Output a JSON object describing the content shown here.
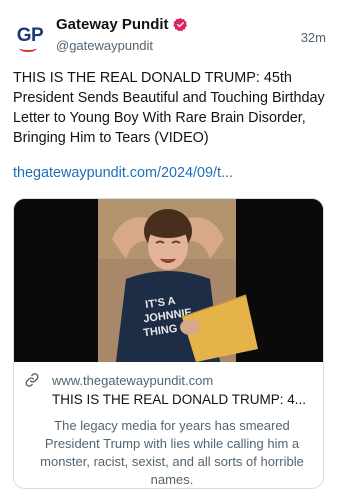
{
  "author": {
    "avatar_text": "GP",
    "display_name": "Gateway Pundit",
    "handle": "@gatewaypundit",
    "verified": true
  },
  "timestamp": "32m",
  "post": {
    "text": "THIS IS THE REAL DONALD TRUMP: 45th President Sends Beautiful and Touching Birthday Letter to Young Boy With Rare Brain Disorder, Bringing Him to Tears (VIDEO)",
    "link_text": "thegatewaypundit.com/2024/09/t..."
  },
  "card": {
    "domain": "www.thegatewaypundit.com",
    "title": "THIS IS THE REAL DONALD TRUMP: 4...",
    "description": "The legacy media for years has smeared President Trump with lies while calling him a monster, racist, sexist, and all sorts of horrible names.",
    "shirt_text": "IT'S A JOHNNIE THING"
  },
  "colors": {
    "link": "#1d6fb8",
    "verified": "#e0245e",
    "brand_navy": "#1b3a78",
    "brand_red": "#d9342b"
  }
}
